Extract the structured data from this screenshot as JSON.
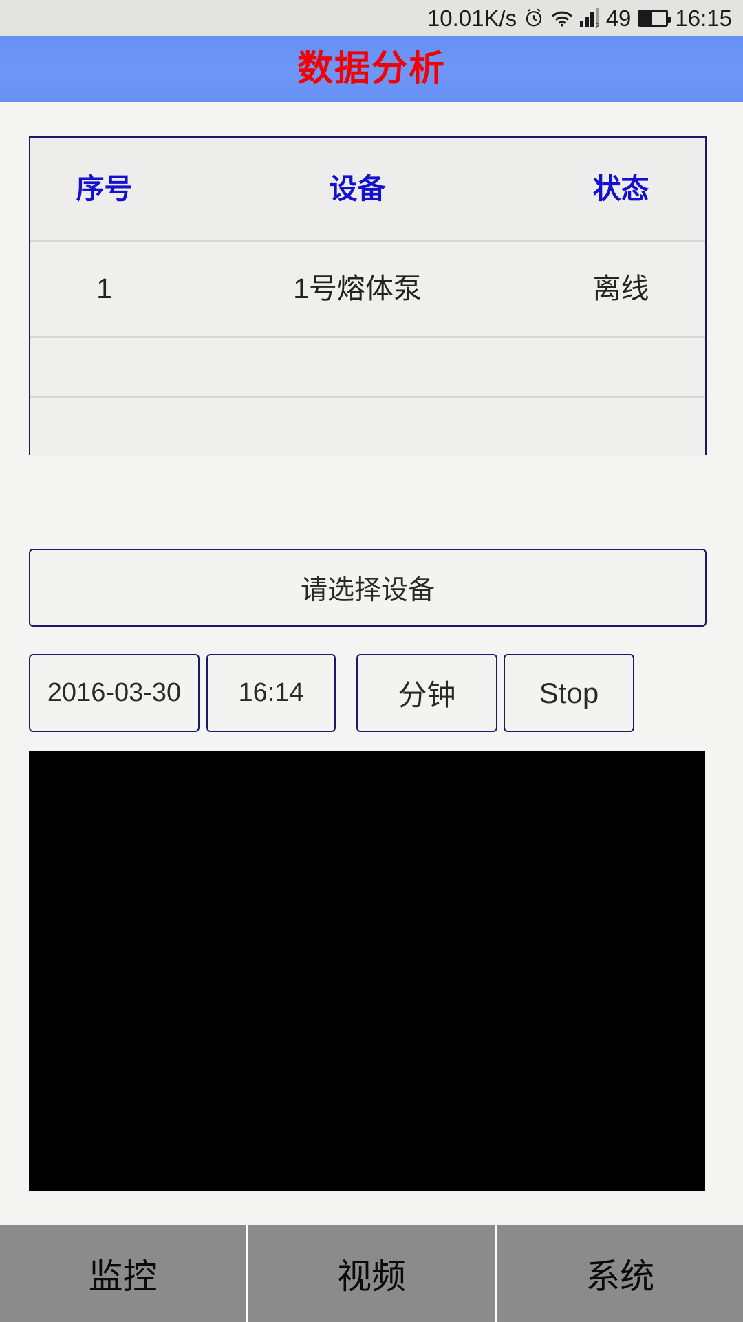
{
  "status_bar": {
    "network_speed": "10.01K/s",
    "alarm_icon": "alarm-clock-icon",
    "wifi_icon": "wifi-icon",
    "signal_icon": "signal-bars-icon",
    "sim_label": "2",
    "battery_percent": "49",
    "battery_icon": "battery-icon",
    "clock": "16:15"
  },
  "title_bar": {
    "title": "数据分析"
  },
  "device_table": {
    "columns": [
      "序号",
      "设备",
      "状态"
    ],
    "rows": [
      {
        "index": "1",
        "device": "1号熔体泵",
        "state": "离线"
      }
    ],
    "empty_rows": 2
  },
  "select_device": {
    "label": "请选择设备"
  },
  "controls": {
    "date": "2016-03-30",
    "time": "16:14",
    "unit": "分钟",
    "action": "Stop"
  },
  "chart": {
    "background_color": "#000000"
  },
  "bottom_nav": {
    "items": [
      {
        "label": "监控"
      },
      {
        "label": "视频"
      },
      {
        "label": "系统"
      }
    ]
  },
  "colors": {
    "title_bar_blue": "#6690f6",
    "title_red": "#f20000",
    "header_blue": "#1410cf",
    "border_navy": "#1b1b63",
    "nav_gray": "#8b8b8b",
    "page_bg": "#f4f4f2"
  }
}
